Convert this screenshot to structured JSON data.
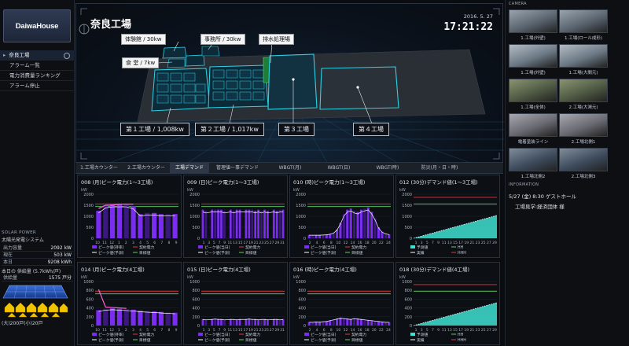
{
  "brand": {
    "logo_text": "DaiwaHouse"
  },
  "nav": {
    "items": [
      {
        "label": "奈良工場"
      },
      {
        "label": "アラーム一覧"
      },
      {
        "label": "電力消費量ランキング"
      },
      {
        "label": "アラーム停止"
      }
    ]
  },
  "solar": {
    "section_title": "SOLAR POWER",
    "system_name": "太陽光発電システム",
    "rows": [
      {
        "key": "出力容量",
        "value": "2092 kW"
      },
      {
        "key": "現在",
        "value": "503 kW"
      },
      {
        "key": "本日",
        "value": "9208 kWh"
      }
    ],
    "cumulative_label": "本日の 供給量 (5.7kWh/戸)",
    "supply_row": {
      "key": "供給量",
      "value": "1575 戸分"
    },
    "bottom_text": "(大)200戸(小)20戸"
  },
  "scene": {
    "title": "奈良工場",
    "date": "2016. 5. 27",
    "time": "17:21:22",
    "labels": {
      "taiken": "体験館 / 30kw",
      "jimusho": "事務所 / 30kw",
      "haisui": "排水処理場",
      "shokudo": "食 堂 / 7kw",
      "f1": "第１工場 / 1,008kw",
      "f2": "第２工場 / 1,017kw",
      "f3": "第３工場",
      "f4": "第４工場"
    }
  },
  "tabs": [
    {
      "label": "1.工場カウンター(時)"
    },
    {
      "label": "2.工場カウンター(時)"
    },
    {
      "label": "工場デマンド"
    },
    {
      "label": "管理値ー事デマンド"
    },
    {
      "label": "WBGT(月)"
    },
    {
      "label": "WBGT(日)"
    },
    {
      "label": "WBGT(時)"
    },
    {
      "label": "防災(月・日・時)"
    }
  ],
  "colors": {
    "bar_purple": "#7a2cf0",
    "bar_dark": "#3b1780",
    "pink_line": "#ff66cc",
    "red_line": "#e03a3a",
    "green_line": "#5fd35f",
    "teal_area": "#3fe0d0",
    "white_line": "#ffffff"
  },
  "chart_data": [
    {
      "type": "bar",
      "title": "008 (月)ピーク電力(1〜3工場)",
      "unit": "kW",
      "ylim": [
        0,
        2000
      ],
      "yticks": [
        "2000",
        "1500",
        "1000",
        "500",
        "0"
      ],
      "xticks": [
        "10",
        "11",
        "12",
        "1",
        "2",
        "3",
        "4",
        "5",
        "6",
        "7",
        "8",
        "9"
      ],
      "values": [
        1250,
        1500,
        1550,
        1550,
        1550,
        1450,
        1100,
        1150,
        1150,
        1100,
        1100,
        1100
      ],
      "overlay_line": [
        1350,
        1500,
        1500,
        1550,
        1550,
        1550
      ],
      "legend": [
        "ピーク値(持率)",
        "契約電力",
        "ピーク値(予測)",
        "目標値"
      ]
    },
    {
      "type": "bar",
      "title": "009 (日)ピーク電力(1〜3工場)",
      "unit": "kW",
      "ylim": [
        0,
        2000
      ],
      "yticks": [
        "2000",
        "1500",
        "1000",
        "500",
        "0"
      ],
      "xticks": [
        "1",
        "3",
        "5",
        "7",
        "9",
        "11",
        "13",
        "15",
        "17",
        "19",
        "21",
        "23",
        "25",
        "27",
        "29",
        "31"
      ],
      "values": [
        1300,
        1250,
        0,
        1300,
        1300,
        1300,
        1300,
        1250,
        0,
        1300,
        1250,
        1300,
        1300,
        0,
        1300,
        1300,
        1300,
        1250,
        1300,
        1250,
        1300,
        1250,
        0,
        1300,
        1250,
        1300,
        1300
      ],
      "legend": [
        "ピーク値(当日)",
        "契約電力",
        "ピーク値(予測)",
        "目標値"
      ]
    },
    {
      "type": "bar",
      "title": "010 (時)ピーク電力(1〜3工場)",
      "unit": "kW",
      "ylim": [
        0,
        2000
      ],
      "yticks": [
        "2000",
        "1500",
        "1000",
        "500",
        "0"
      ],
      "xticks": [
        "2",
        "4",
        "6",
        "8",
        "10",
        "12",
        "14",
        "16",
        "18",
        "20",
        "22",
        "24"
      ],
      "values": [
        150,
        150,
        150,
        150,
        160,
        170,
        200,
        250,
        400,
        700,
        1100,
        1300,
        1350,
        1250,
        1200,
        1300,
        1350,
        1400,
        1200,
        900,
        500,
        300,
        220,
        180
      ],
      "legend": [
        "ピーク値(当日)",
        "契約電力",
        "ピーク値(予測)",
        "目標値"
      ]
    },
    {
      "type": "area",
      "title": "012 (30分)デマンド値(1〜3工場)",
      "unit": "kW",
      "ylim": [
        0,
        2000
      ],
      "yticks": [
        "2000",
        "1500",
        "1000",
        "500",
        "0"
      ],
      "xticks": [
        "1",
        "3",
        "5",
        "7",
        "9",
        "11",
        "13",
        "15",
        "17",
        "19",
        "21",
        "23",
        "25",
        "27",
        "29"
      ],
      "legend": [
        "予測値",
        "HH",
        "実績",
        "HHH"
      ]
    },
    {
      "type": "bar",
      "title": "014 (月)ピーク電力(4工場)",
      "unit": "kW",
      "ylim": [
        0,
        1000
      ],
      "yticks": [
        "1000",
        "800",
        "600",
        "400",
        "200",
        "0"
      ],
      "xticks": [
        "10",
        "11",
        "12",
        "1",
        "2",
        "3",
        "4",
        "5",
        "6",
        "7",
        "8",
        "9"
      ],
      "values": [
        350,
        380,
        390,
        380,
        370,
        360,
        340,
        330,
        320,
        310,
        300,
        290
      ],
      "overlay_line": [
        820,
        420,
        410,
        400,
        390
      ],
      "legend": [
        "ピーク値(持率)",
        "契約電力",
        "ピーク値(予測)",
        "目標値"
      ]
    },
    {
      "type": "bar",
      "title": "015 (日)ピーク電力(4工場)",
      "unit": "kW",
      "ylim": [
        0,
        1000
      ],
      "yticks": [
        "1000",
        "800",
        "600",
        "400",
        "200",
        "0"
      ],
      "xticks": [
        "1",
        "3",
        "5",
        "7",
        "9",
        "11",
        "13",
        "15",
        "17",
        "19",
        "21",
        "23",
        "25",
        "27",
        "29",
        "31"
      ],
      "values": [
        150,
        140,
        0,
        150,
        160,
        150,
        150,
        140,
        0,
        150,
        150,
        140,
        150,
        0,
        150,
        160,
        150,
        150,
        140,
        150,
        150,
        140,
        0,
        150,
        150,
        140,
        150
      ],
      "legend": [
        "ピーク値(当日)",
        "契約電力",
        "ピーク値(予測)",
        "目標値"
      ]
    },
    {
      "type": "bar",
      "title": "016 (時)ピーク電力(4工場)",
      "unit": "kW",
      "ylim": [
        0,
        1000
      ],
      "yticks": [
        "1000",
        "800",
        "600",
        "400",
        "200",
        "0"
      ],
      "xticks": [
        "2",
        "4",
        "6",
        "8",
        "10",
        "12",
        "14",
        "16",
        "18",
        "20",
        "22",
        "24"
      ],
      "values": [
        80,
        80,
        90,
        85,
        95,
        100,
        120,
        140,
        160,
        180,
        170,
        160,
        150,
        170,
        160,
        150,
        140,
        130,
        120,
        110,
        100,
        90,
        80,
        80
      ],
      "legend": [
        "ピーク値(当日)",
        "契約電力",
        "ピーク値(予測)",
        "目標値"
      ]
    },
    {
      "type": "area",
      "title": "018 (30分)デマンド値(4工場)",
      "unit": "kW",
      "ylim": [
        0,
        1000
      ],
      "yticks": [
        "1000",
        "800",
        "600",
        "400",
        "200",
        "0"
      ],
      "xticks": [
        "1",
        "3",
        "5",
        "7",
        "9",
        "11",
        "13",
        "15",
        "17",
        "19",
        "21",
        "23",
        "25",
        "27",
        "29"
      ],
      "legend": [
        "予測値",
        "HH",
        "実績",
        "HHH"
      ]
    }
  ],
  "cameras": {
    "header": "CAMERA",
    "items": [
      {
        "label": "1.工場(外壁)"
      },
      {
        "label": "1.工場(ロール成形)"
      },
      {
        "label": ""
      },
      {
        "label": "1.工場(外壁)"
      },
      {
        "label": "1.工場(大間元)"
      },
      {
        "label": ""
      },
      {
        "label": "1.工場(全体)"
      },
      {
        "label": "2.工場(大鴻元)"
      },
      {
        "label": ""
      },
      {
        "label": "電着塗装ライン"
      },
      {
        "label": "2.工場北側1"
      },
      {
        "label": ""
      },
      {
        "label": "1.工場北側2"
      },
      {
        "label": "2.工場北側3"
      },
      {
        "label": ""
      }
    ]
  },
  "information": {
    "header": "INFORMATION",
    "line1": "5/27 (金) 8:30 ゲストホール",
    "line2": "工場見学:経済団体 様"
  }
}
